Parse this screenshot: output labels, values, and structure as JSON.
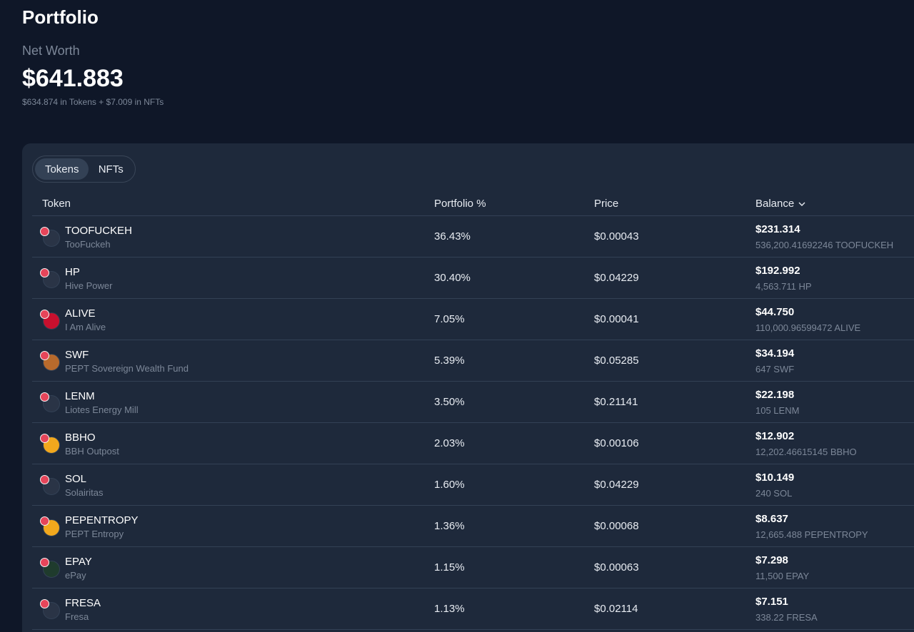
{
  "header": {
    "title": "Portfolio",
    "networth_label": "Net Worth",
    "networth_value": "$641.883",
    "breakdown": "$634.874 in Tokens + $7.009 in NFTs"
  },
  "tabs": [
    {
      "label": "Tokens",
      "active": true
    },
    {
      "label": "NFTs",
      "active": false
    }
  ],
  "columns": {
    "token": "Token",
    "portfolio_pct": "Portfolio %",
    "price": "Price",
    "balance": "Balance"
  },
  "colors": {
    "background": "#0f1728",
    "panel": "#1e293b",
    "badge": "#e6455a"
  },
  "tokens": [
    {
      "symbol": "TOOFUCKEH",
      "name": "TooFuckeh",
      "pct": "36.43%",
      "price": "$0.00043",
      "usd": "$231.314",
      "amount": "536,200.41692246 TOOFUCKEH",
      "icon": "default-token-icon",
      "disc": "#2a3446"
    },
    {
      "symbol": "HP",
      "name": "Hive Power",
      "pct": "30.40%",
      "price": "$0.04229",
      "usd": "$192.992",
      "amount": "4,563.711 HP",
      "icon": "default-token-icon",
      "disc": "#2a3446"
    },
    {
      "symbol": "ALIVE",
      "name": "I Am Alive",
      "pct": "7.05%",
      "price": "$0.00041",
      "usd": "$44.750",
      "amount": "110,000.96599472 ALIVE",
      "icon": "alive-token-icon",
      "disc": "#c8102e"
    },
    {
      "symbol": "SWF",
      "name": "PEPT Sovereign Wealth Fund",
      "pct": "5.39%",
      "price": "$0.05285",
      "usd": "$34.194",
      "amount": "647 SWF",
      "icon": "swf-token-icon",
      "disc": "#b86a2c"
    },
    {
      "symbol": "LENM",
      "name": "Liotes Energy Mill",
      "pct": "3.50%",
      "price": "$0.21141",
      "usd": "$22.198",
      "amount": "105 LENM",
      "icon": "default-token-icon",
      "disc": "#2a3446"
    },
    {
      "symbol": "BBHO",
      "name": "BBH Outpost",
      "pct": "2.03%",
      "price": "$0.00106",
      "usd": "$12.902",
      "amount": "12,202.46615145 BBHO",
      "icon": "coin-token-icon",
      "disc": "#f2a81d"
    },
    {
      "symbol": "SOL",
      "name": "Solairitas",
      "pct": "1.60%",
      "price": "$0.04229",
      "usd": "$10.149",
      "amount": "240 SOL",
      "icon": "default-token-icon",
      "disc": "#2a3446"
    },
    {
      "symbol": "PEPENTROPY",
      "name": "PEPT Entropy",
      "pct": "1.36%",
      "price": "$0.00068",
      "usd": "$8.637",
      "amount": "12,665.488 PEPENTROPY",
      "icon": "coin-token-icon",
      "disc": "#f2a81d"
    },
    {
      "symbol": "EPAY",
      "name": "ePay",
      "pct": "1.15%",
      "price": "$0.00063",
      "usd": "$7.298",
      "amount": "11,500 EPAY",
      "icon": "epay-token-icon",
      "disc": "#1f3b2d"
    },
    {
      "symbol": "FRESA",
      "name": "Fresa",
      "pct": "1.13%",
      "price": "$0.02114",
      "usd": "$7.151",
      "amount": "338.22 FRESA",
      "icon": "default-token-icon",
      "disc": "#2a3446"
    }
  ]
}
